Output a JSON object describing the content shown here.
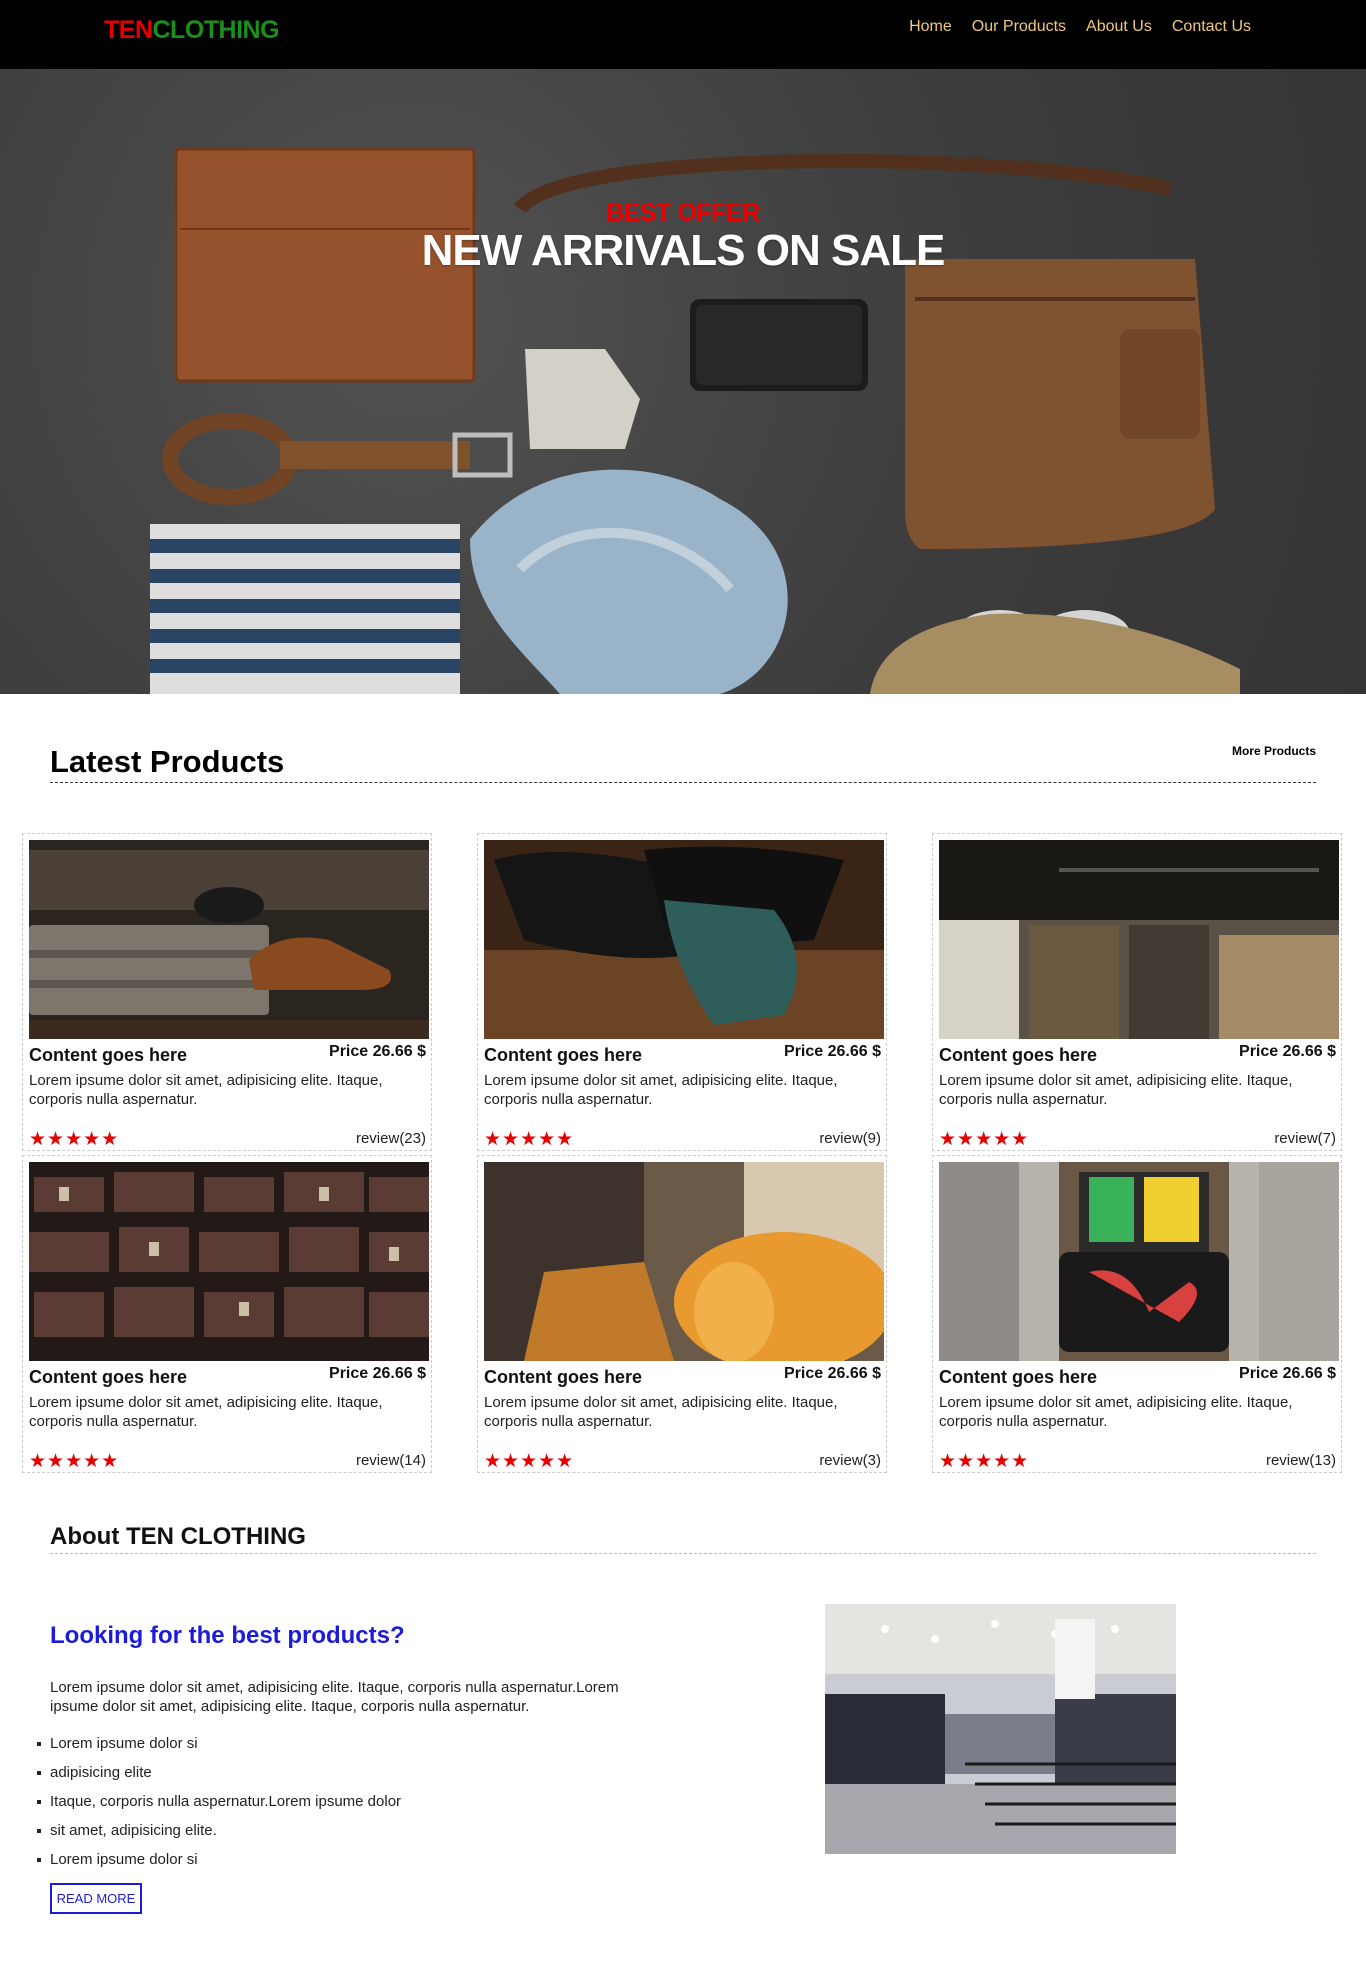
{
  "brand": {
    "part1": "TEN",
    "part2": "CLOTHING"
  },
  "nav": [
    "Home",
    "Our Products",
    "About Us",
    "Contact Us"
  ],
  "hero": {
    "offer": "BEST OFFER",
    "headline": "NEW ARRIVALS ON SALE"
  },
  "latest": {
    "title": "Latest Products",
    "more": "More Products"
  },
  "products": [
    {
      "title": "Content goes here",
      "price": "Price 26.66 $",
      "desc": "Lorem ipsume dolor sit amet, adipisicing elite. Itaque, corporis nulla aspernatur.",
      "stars": "★★★★★",
      "review": "review(23)"
    },
    {
      "title": "Content goes here",
      "price": "Price 26.66 $",
      "desc": "Lorem ipsume dolor sit amet, adipisicing elite. Itaque, corporis nulla aspernatur.",
      "stars": "★★★★★",
      "review": "review(9)"
    },
    {
      "title": "Content goes here",
      "price": "Price 26.66 $",
      "desc": "Lorem ipsume dolor sit amet, adipisicing elite. Itaque, corporis nulla aspernatur.",
      "stars": "★★★★★",
      "review": "review(7)"
    },
    {
      "title": "Content goes here",
      "price": "Price 26.66 $",
      "desc": "Lorem ipsume dolor sit amet, adipisicing elite. Itaque, corporis nulla aspernatur.",
      "stars": "★★★★★",
      "review": "review(14)"
    },
    {
      "title": "Content goes here",
      "price": "Price 26.66 $",
      "desc": "Lorem ipsume dolor sit amet, adipisicing elite. Itaque, corporis nulla aspernatur.",
      "stars": "★★★★★",
      "review": "review(3)"
    },
    {
      "title": "Content goes here",
      "price": "Price 26.66 $",
      "desc": "Lorem ipsume dolor sit amet, adipisicing elite. Itaque, corporis nulla aspernatur.",
      "stars": "★★★★★",
      "review": "review(13)"
    }
  ],
  "about": {
    "title": "About TEN CLOTHING",
    "subtitle": "Looking for the best products?",
    "paragraph": "Lorem ipsume dolor sit amet, adipisicing elite. Itaque, corporis nulla aspernatur.Lorem ipsume dolor sit amet, adipisicing elite. Itaque, corporis nulla aspernatur.",
    "list": [
      "Lorem ipsume dolor si",
      "adipisicing elite",
      "Itaque, corporis nulla aspernatur.Lorem ipsume dolor",
      "sit amet, adipisicing elite.",
      "Lorem ipsume dolor si"
    ],
    "button": "READ MORE"
  },
  "colors": {
    "brand_red": "#e60000",
    "brand_green": "#1a8f1a",
    "nav_link": "#f1c87a",
    "accent_blue": "#1c1cd8"
  }
}
